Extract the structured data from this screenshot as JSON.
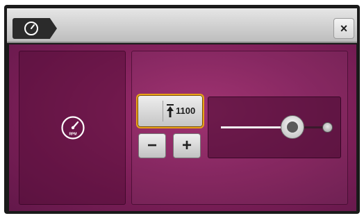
{
  "header": {
    "tab_icon": "speedometer-icon",
    "close_label": "×"
  },
  "left_panel": {
    "icon": "rpm-gauge-icon",
    "icon_text": "RPM"
  },
  "preset": {
    "icon": "arrow-up-to-limit-icon",
    "value": "1100",
    "selected": true,
    "accent_color": "#e8a318"
  },
  "stepper": {
    "minus_label": "−",
    "plus_label": "+"
  },
  "slider": {
    "level": 0.72
  },
  "colors": {
    "background": "#7d1f58",
    "header": "#d0d0d0"
  }
}
